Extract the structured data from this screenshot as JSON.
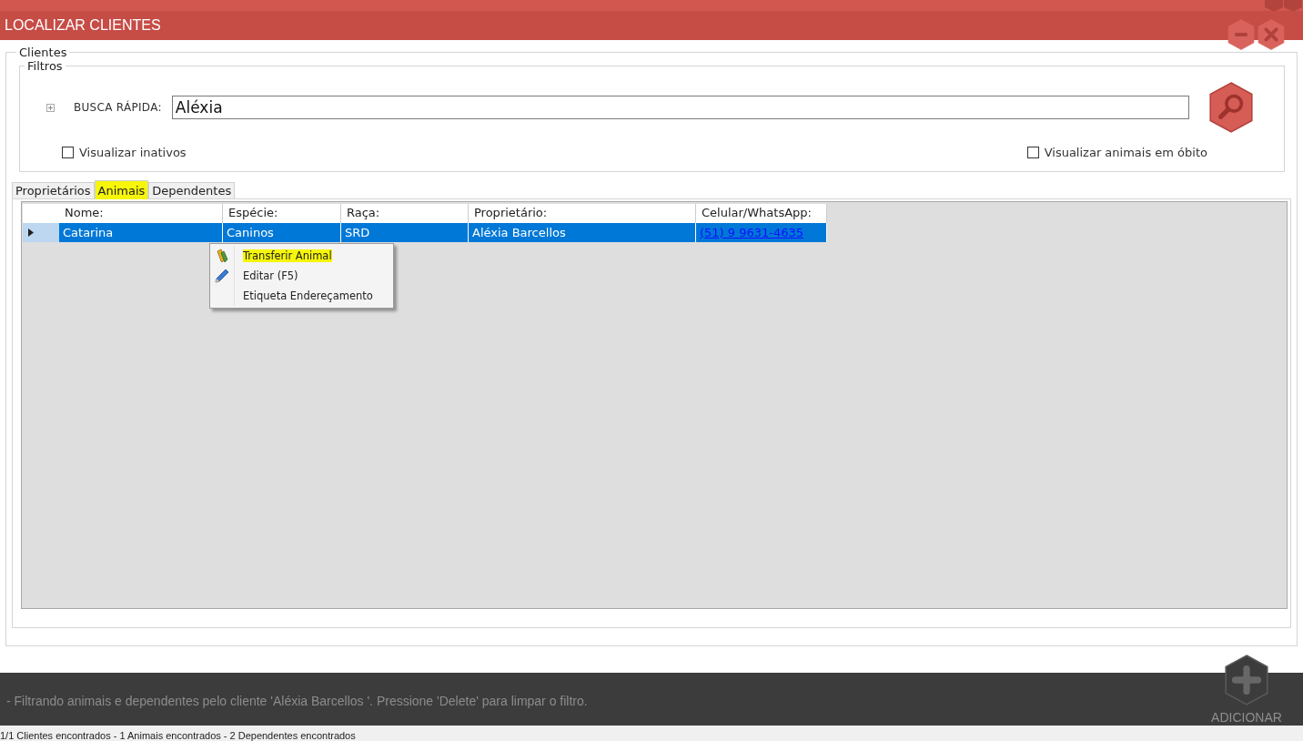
{
  "window": {
    "title": "LOCALIZAR CLIENTES"
  },
  "group": {
    "title": "Clientes"
  },
  "filters": {
    "title": "Filtros",
    "search": {
      "label": "BUSCA RÁPIDA:",
      "value": "Aléxia"
    },
    "checkboxes": [
      {
        "label": "Visualizar inativos",
        "checked": false
      },
      {
        "label": "Visualizar animais em óbito",
        "checked": false
      }
    ]
  },
  "tabs": [
    {
      "label": "Proprietários",
      "selected": false,
      "highlighted": false
    },
    {
      "label": "Animais",
      "selected": true,
      "highlighted": true
    },
    {
      "label": "Dependentes",
      "selected": false,
      "highlighted": false
    }
  ],
  "table": {
    "columns": [
      {
        "label": "Nome:",
        "kind": "text"
      },
      {
        "label": "Espécie:",
        "kind": "text"
      },
      {
        "label": "Raça:",
        "kind": "text"
      },
      {
        "label": "Proprietário:",
        "kind": "text"
      },
      {
        "label": "Celular/WhatsApp:",
        "kind": "link"
      }
    ],
    "rows": [
      {
        "selected": true,
        "cells": [
          "Catarina",
          "Caninos",
          "SRD",
          "Aléxia Barcellos",
          "(51) 9 9631-4635"
        ]
      }
    ]
  },
  "context_menu": {
    "items": [
      {
        "label": "Transferir Animal",
        "kind": "transfer",
        "highlighted": true
      },
      {
        "label": "Editar (F5)",
        "kind": "edit",
        "highlighted": false
      },
      {
        "label": "Etiqueta Endereçamento",
        "kind": "plain",
        "highlighted": false
      }
    ]
  },
  "footer": {
    "message": "- Filtrando animais e dependentes pelo cliente 'Aléxia Barcellos '. Pressione 'Delete' para limpar o filtro.",
    "add_button": "ADICIONAR"
  },
  "status_bar": {
    "text": "1/1 Clientes encontrados - 1 Animais encontrados - 2 Dependentes encontrados"
  }
}
